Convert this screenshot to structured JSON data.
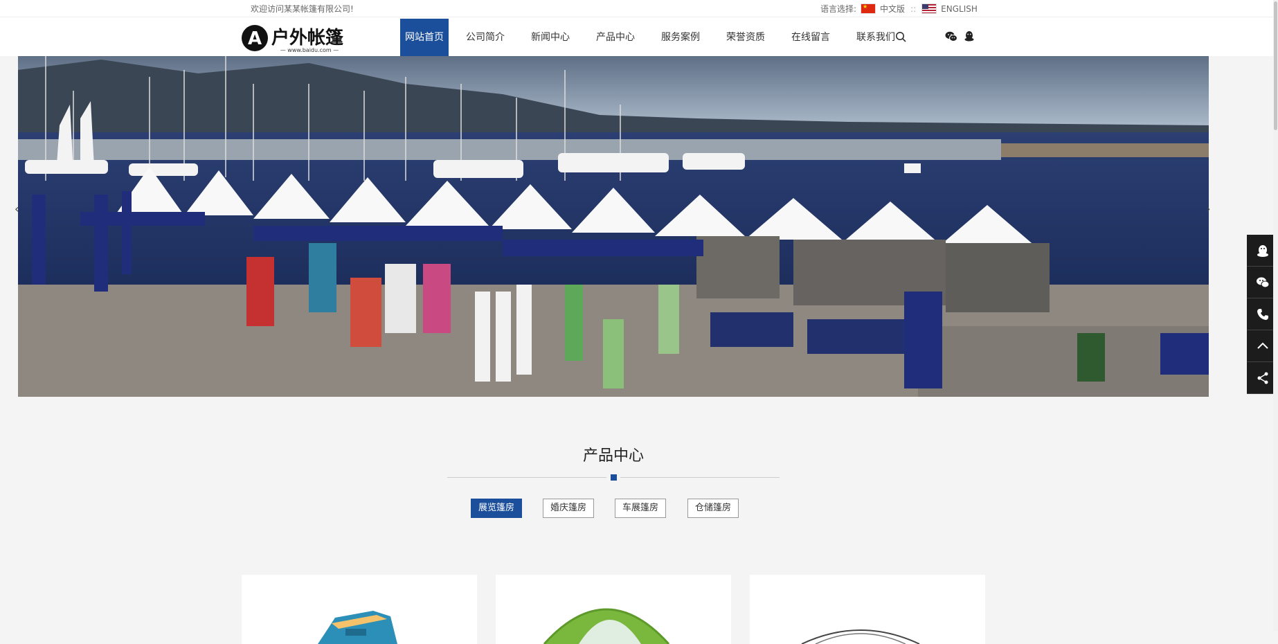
{
  "topbar": {
    "welcome": "欢迎访问某某帐篷有限公司!",
    "lang_label": "语言选择:",
    "lang_cn": "中文版",
    "lang_sep": "::",
    "lang_en": "ENGLISH"
  },
  "logo": {
    "text": "户外帐篷",
    "sub": "— www.baidu.com —"
  },
  "nav": {
    "items": [
      {
        "label": "网站首页"
      },
      {
        "label": "公司简介"
      },
      {
        "label": "新闻中心"
      },
      {
        "label": "产品中心"
      },
      {
        "label": "服务案例"
      },
      {
        "label": "荣誉资质"
      },
      {
        "label": "在线留言"
      },
      {
        "label": "联系我们"
      }
    ]
  },
  "section": {
    "title": "产品中心",
    "tabs": [
      {
        "label": "展览篷房"
      },
      {
        "label": "婚庆篷房"
      },
      {
        "label": "车展篷房"
      },
      {
        "label": "仓储篷房"
      }
    ]
  },
  "colors": {
    "accent": "#1b4f9c",
    "side_bg": "#1c1c1c"
  },
  "icons": [
    "search-icon",
    "wechat-icon",
    "qq-icon",
    "phone-icon",
    "back-to-top-icon",
    "share-icon"
  ]
}
